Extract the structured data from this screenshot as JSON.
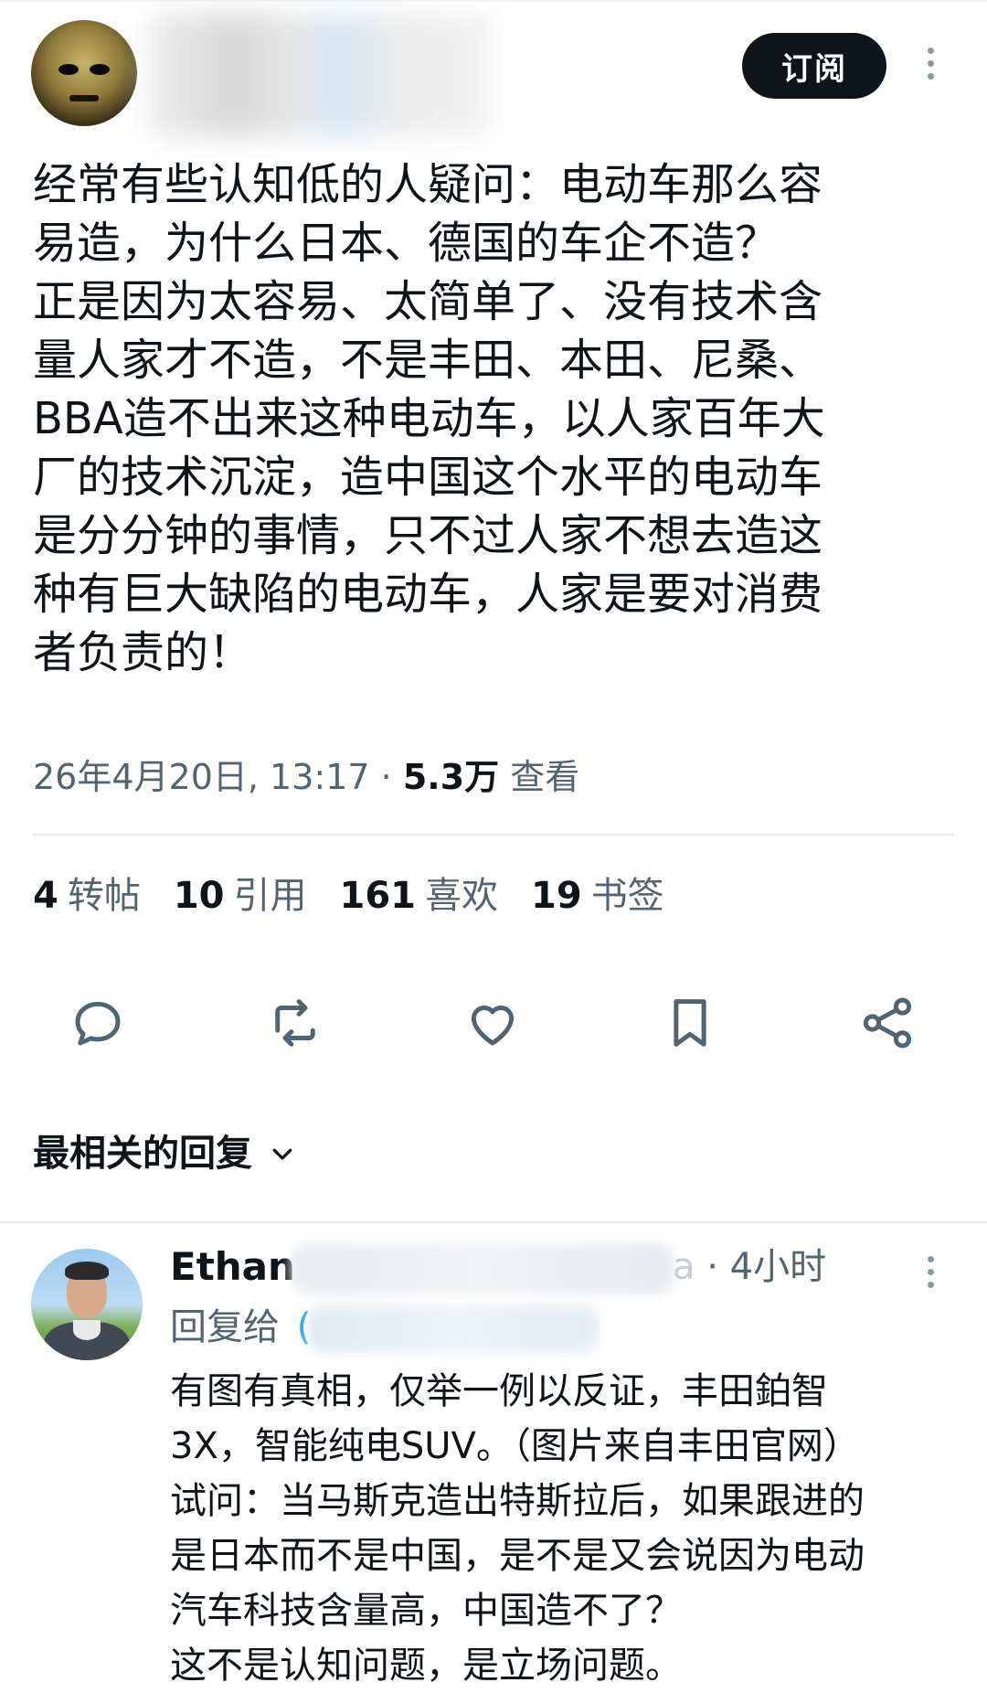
{
  "post": {
    "subscribe_label": "订阅",
    "text": "经常有些认知低的人疑问：电动车那么容\n易造，为什么日本、德国的车企不造？\n正是因为太容易、太简单了、没有技术含\n量人家才不造，不是丰田、本田、尼桑、\nBBA造不出来这种电动车，以人家百年大\n厂的技术沉淀，造中国这个水平的电动车\n是分分钟的事情，只不过人家不想去造这\n种有巨大缺陷的电动车，人家是要对消费\n者负责的！",
    "timestamp": "26年4月20日, 13:17",
    "separator": " · ",
    "views_count": "5.3万",
    "views_label": "查看"
  },
  "stats": [
    {
      "count": "4",
      "label": "转帖"
    },
    {
      "count": "10",
      "label": "引用"
    },
    {
      "count": "161",
      "label": "喜欢"
    },
    {
      "count": "19",
      "label": "书签"
    }
  ],
  "actions": [
    "reply-icon",
    "repost-icon",
    "like-icon",
    "bookmark-icon",
    "share-icon"
  ],
  "replies_heading": "最相关的回复",
  "reply": {
    "author_name": "Ethan",
    "handle_tail": "a",
    "time": "· 4小时",
    "reply_to_label": "回复给",
    "reply_to_mark": "(",
    "text": "有图有真相，仅举一例以反证，丰田鉑智\n3X，智能纯电SUV。（图片来自丰田官网）\n试问：当马斯克造出特斯拉后，如果跟进的\n是日本而不是中国，是不是又会说因为电动\n汽车科技含量高，中国造不了？\n这不是认知问题，是立场问题。"
  },
  "colors": {
    "text_primary": "#0f1419",
    "text_secondary": "#536471",
    "divider": "#e3e8eb",
    "button_bg": "#0f1419"
  }
}
